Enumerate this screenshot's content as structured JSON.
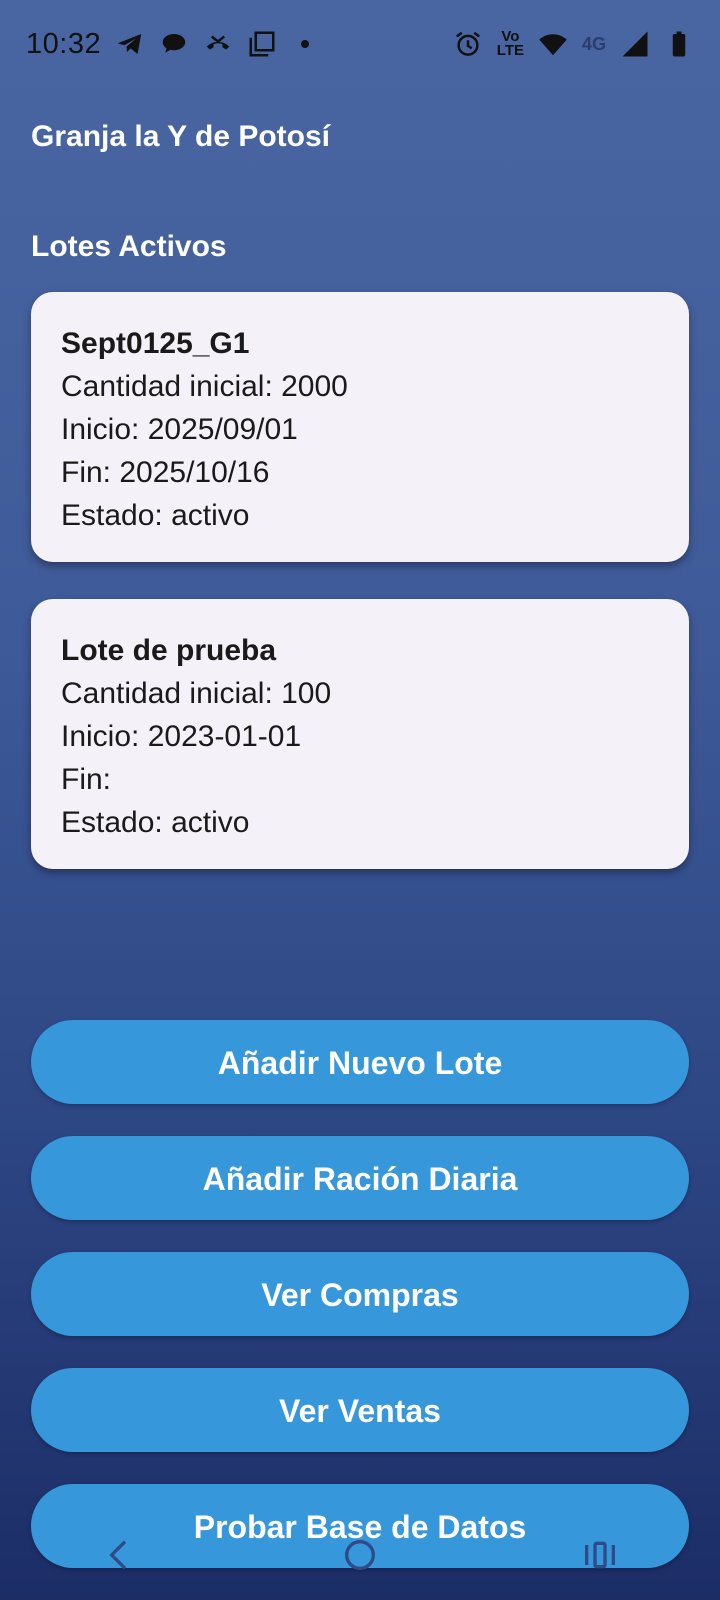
{
  "status_bar": {
    "time": "10:32",
    "left_icons": [
      "telegram-icon",
      "chat-bubble-icon",
      "missed-call-icon",
      "screen-cast-icon",
      "notification-dot-icon"
    ],
    "right_icons": [
      "alarm-icon",
      "volte-icon",
      "wifi-icon",
      "4g-signal-icon",
      "battery-icon"
    ],
    "volte_label_top": "Vo",
    "volte_label_bottom": "LTE",
    "network_label": "4G"
  },
  "app": {
    "title": "Granja la Y de Potosí",
    "section_title": "Lotes Activos"
  },
  "lots": [
    {
      "name": "Sept0125_G1",
      "cantidad": "Cantidad inicial: 2000",
      "inicio": "Inicio: 2025/09/01",
      "fin": "Fin: 2025/10/16",
      "estado": "Estado: activo"
    },
    {
      "name": "Lote de prueba",
      "cantidad": "Cantidad inicial: 100",
      "inicio": "Inicio: 2023-01-01",
      "fin": "Fin:",
      "estado": "Estado: activo"
    }
  ],
  "actions": {
    "add_lot": "Añadir Nuevo Lote",
    "add_ration": "Añadir Ración Diaria",
    "view_purchases": "Ver Compras",
    "view_sales": "Ver Ventas",
    "test_db": "Probar Base de Datos"
  },
  "colors": {
    "background_top": "#4a66a2",
    "background_bottom": "#1c2d66",
    "card": "#f4f1f8",
    "button": "#3697db",
    "text_light": "#ffffff",
    "text_dark": "#1a1a1a"
  },
  "nav_bar": {
    "icons": [
      "back-icon",
      "home-icon",
      "recent-apps-icon"
    ]
  }
}
